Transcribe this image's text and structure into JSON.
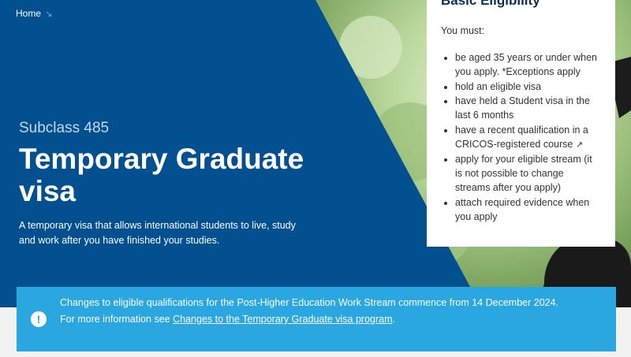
{
  "breadcrumb": {
    "home": "Home",
    "arrow": "↘"
  },
  "hero": {
    "subclass": "Subclass 485",
    "title": "Temporary Graduate visa",
    "intro": "A temporary visa that allows international students to live, study and work after you have finished your studies."
  },
  "eligibility": {
    "heading": "Basic Eligibility",
    "lead": "You must:",
    "items": [
      "be aged 35 years or under when you apply. *Exceptions apply",
      "hold an eligible visa",
      "have held a Student visa in the last 6 months",
      "have a recent qualification in a CRICOS-registered course",
      "apply for your eligible stream (it is not possible to change streams after you apply)",
      "attach required evidence when you apply"
    ],
    "external_icon": "↗"
  },
  "notice": {
    "icon": "!",
    "line1": "Changes to eligible qualifications for the Post-Higher Education Work Stream commence from 14 December 2024.",
    "line2_prefix": "For more information see ",
    "link_text": "Changes to the Temporary Graduate visa program",
    "line2_suffix": "."
  },
  "colors": {
    "hero_blue": "#02508f",
    "notice_blue": "#2aa7e0",
    "heading_navy": "#0c2d57"
  }
}
